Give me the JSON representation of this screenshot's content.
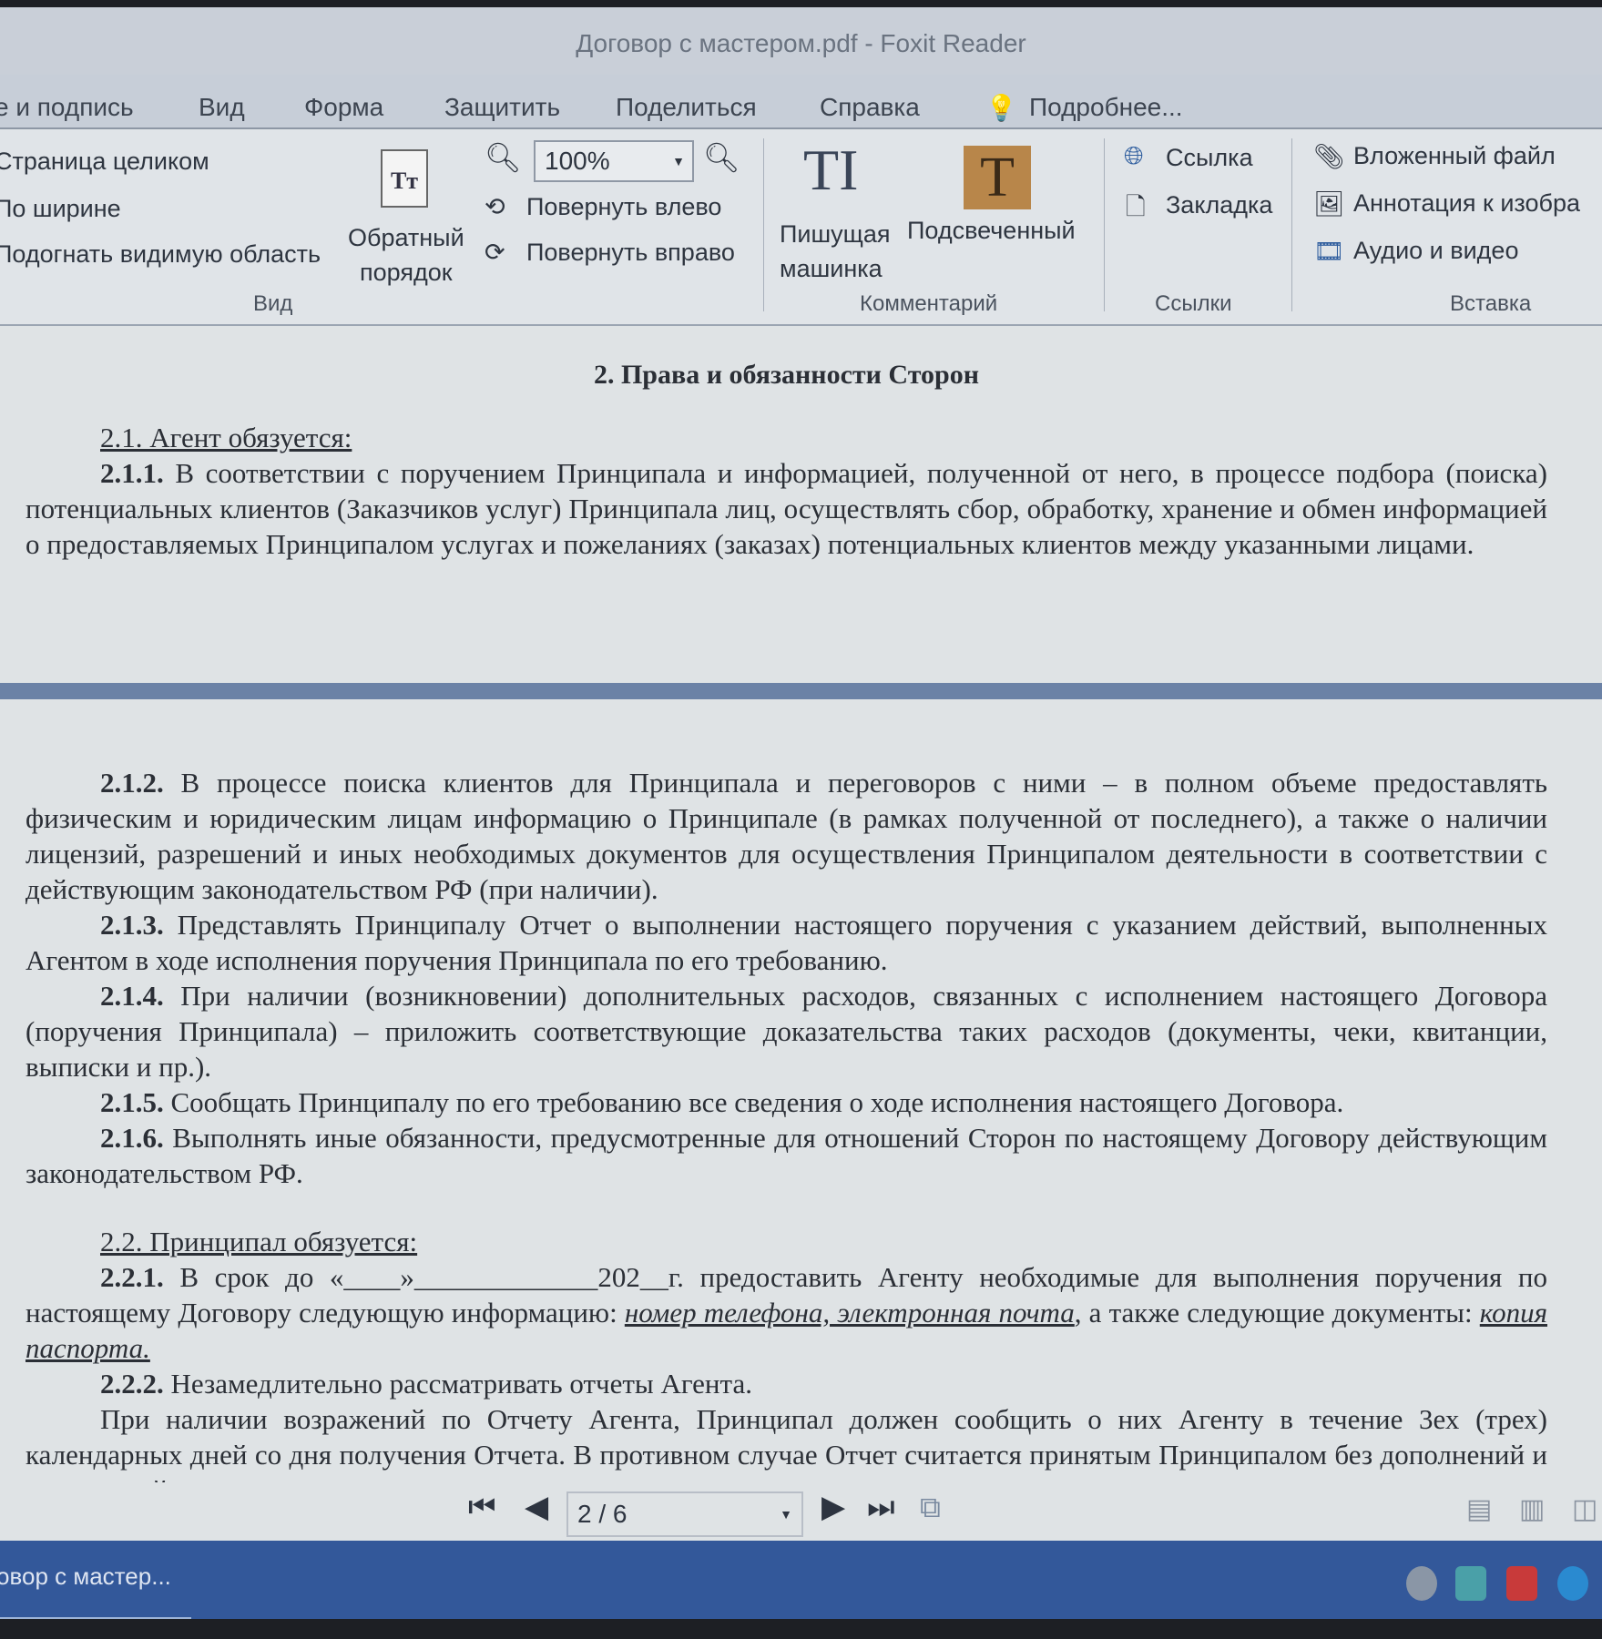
{
  "window": {
    "title": "Договор с мастером.pdf - Foxit Reader"
  },
  "menu": [
    "е и подпись",
    "Вид",
    "Форма",
    "Защитить",
    "Поделиться",
    "Справка"
  ],
  "tell_me": "Подробнее...",
  "ribbon": {
    "view": {
      "page_fit": "Страница целиком",
      "fit_width": "По ширине",
      "fit_visible": "Подогнать видимую область",
      "reverse_l1": "Обратный",
      "reverse_l2": "порядок",
      "zoom_value": "100%",
      "rotate_left": "Повернуть влево",
      "rotate_right": "Повернуть вправо",
      "group": "Вид"
    },
    "comment": {
      "typewriter_l1": "Пишущая",
      "typewriter_l2": "машинка",
      "highlight": "Подсвеченный",
      "group": "Комментарий",
      "highlight_color": "#b8864a"
    },
    "links": {
      "link": "Ссылка",
      "bookmark": "Закладка",
      "group": "Ссылки"
    },
    "insert": {
      "attachment": "Вложенный файл",
      "image_annotation": "Аннотация к изобра",
      "audio_video": "Аудио и видео",
      "group": "Вставка"
    }
  },
  "doc": {
    "heading": "2. Права и обязанности Сторон",
    "s21_title": "2.1. Агент обязуется:",
    "p211_num": "2.1.1.",
    "p211": " В соответствии с поручением Принципала и информацией, полученной от него, в процессе подбора (поиска) потенциальных клиентов (Заказчиков услуг) Принципала лиц, осуществлять сбор, обработку, хранение и обмен информацией о предоставляемых Принципалом услугах и пожеланиях (заказах) потенциальных клиентов между указанными лицами.",
    "p212_num": "2.1.2.",
    "p212": " В процессе поиска клиентов для Принципала и переговоров с ними – в полном объеме предоставлять физическим и юридическим лицам информацию о Принципале (в рамках полученной от последнего), а также о наличии лицензий, разрешений и иных необходимых документов для осуществления Принципалом деятельности в соответствии с действующим законодательством РФ (при наличии).",
    "p213_num": "2.1.3.",
    "p213": " Представлять Принципалу Отчет о выполнении настоящего поручения с указанием действий, выполненных Агентом в ходе исполнения поручения Принципала по его требованию.",
    "p214_num": "2.1.4.",
    "p214": " При наличии (возникновении) дополнительных расходов, связанных с исполнением настоящего Договора (поручения Принципала) – приложить соответствующие доказательства таких расходов (документы, чеки, квитанции, выписки и пр.).",
    "p215_num": "2.1.5.",
    "p215": " Сообщать Принципалу по его требованию все сведения о ходе исполнения настоящего Договора.",
    "p216_num": "2.1.6.",
    "p216": " Выполнять иные обязанности, предусмотренные для отношений Сторон по настоящему Договору действующим законодательством РФ.",
    "s22_title": "2.2. Принципал обязуется:",
    "p221_num": "2.2.1.",
    "p221_a": " В срок до «____»_____________202__г. предоставить Агенту необходимые для выполнения поручения по настоящему Договору следующую информацию: ",
    "p221_u1": "номер телефона, электронная почта",
    "p221_b": ", а также следующие документы: ",
    "p221_u2": "копия паспорта.",
    "p222_num": "2.2.2.",
    "p222": " Незамедлительно рассматривать отчеты Агента.",
    "p223": "При наличии возражений по Отчету Агента, Принципал должен сообщить о них Агенту в течение 3ех (трех) календарных дней со дня получения Отчета. В противном случае Отчет считается принятым Принципалом без дополнений и возражений."
  },
  "nav": {
    "page": "2 / 6"
  },
  "taskbar": {
    "app": "овор с мастер..."
  }
}
